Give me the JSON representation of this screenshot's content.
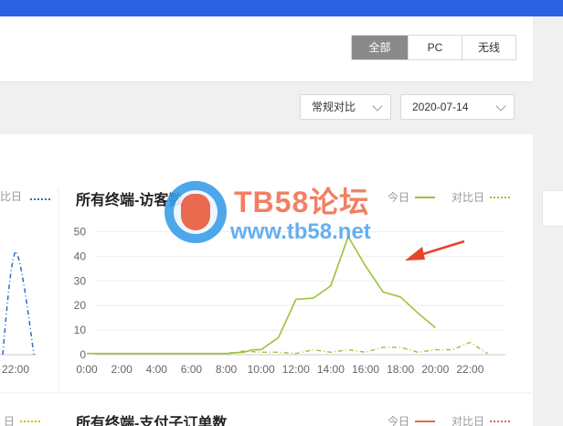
{
  "terminal_tabs": [
    {
      "label": "全部",
      "active": true
    },
    {
      "label": "PC",
      "active": false
    },
    {
      "label": "无线",
      "active": false
    }
  ],
  "compare_select": {
    "value": "常规对比"
  },
  "date_select": {
    "value": "2020-07-14"
  },
  "left_chart": {
    "legend_tail": "比日",
    "x_tick": "22:00",
    "bottom_legend_tail": "日"
  },
  "visitors_panel": {
    "title": "所有终端-访客数",
    "legend": {
      "today": "今日",
      "compare": "对比日"
    },
    "colors": {
      "today": "#9ac33b",
      "compare": "#9ac33b",
      "arrow": "#e8432b"
    }
  },
  "orders_panel": {
    "title": "所有终端-支付子订单数",
    "legend": {
      "today": "今日",
      "compare": "对比日"
    },
    "colors": {
      "today": "#e7664a",
      "compare": "#e7664a"
    }
  },
  "watermark": {
    "line1": "TB58论坛",
    "line2": "www.tb58.net"
  },
  "chart_data": {
    "type": "line",
    "title": "所有终端-访客数",
    "x_ticks": [
      "0:00",
      "2:00",
      "4:00",
      "6:00",
      "8:00",
      "10:00",
      "12:00",
      "14:00",
      "16:00",
      "18:00",
      "20:00",
      "22:00"
    ],
    "y_ticks": [
      0,
      10,
      20,
      30,
      40,
      50
    ],
    "ylim": [
      0,
      55
    ],
    "xlim": [
      0,
      23.5
    ],
    "grid": true,
    "legend_position": "top-right",
    "series": [
      {
        "name": "今日",
        "style": "solid",
        "x": [
          0,
          1,
          2,
          3,
          4,
          5,
          6,
          7,
          8,
          9,
          9.5,
          10,
          11,
          12,
          13,
          14,
          15,
          16,
          17,
          18,
          19,
          20
        ],
        "y": [
          0.5,
          0.5,
          0.5,
          0.5,
          0.5,
          0.5,
          0.5,
          0.5,
          0.5,
          1,
          2,
          2,
          7,
          22.5,
          23,
          28,
          48,
          36,
          25.5,
          23.5,
          17,
          11
        ]
      },
      {
        "name": "对比日",
        "style": "dashed",
        "x": [
          0,
          1,
          2,
          3,
          4,
          5,
          6,
          7,
          8,
          9,
          10,
          11,
          12,
          13,
          14,
          15,
          16,
          17,
          18,
          19,
          20,
          21,
          22,
          23
        ],
        "y": [
          0.5,
          0.5,
          0.5,
          0.5,
          0.5,
          0.5,
          0.5,
          0.5,
          0.5,
          1.5,
          1,
          1,
          0.5,
          2,
          1,
          2,
          1,
          3,
          3,
          1,
          2,
          2,
          5,
          0.5
        ]
      }
    ]
  }
}
